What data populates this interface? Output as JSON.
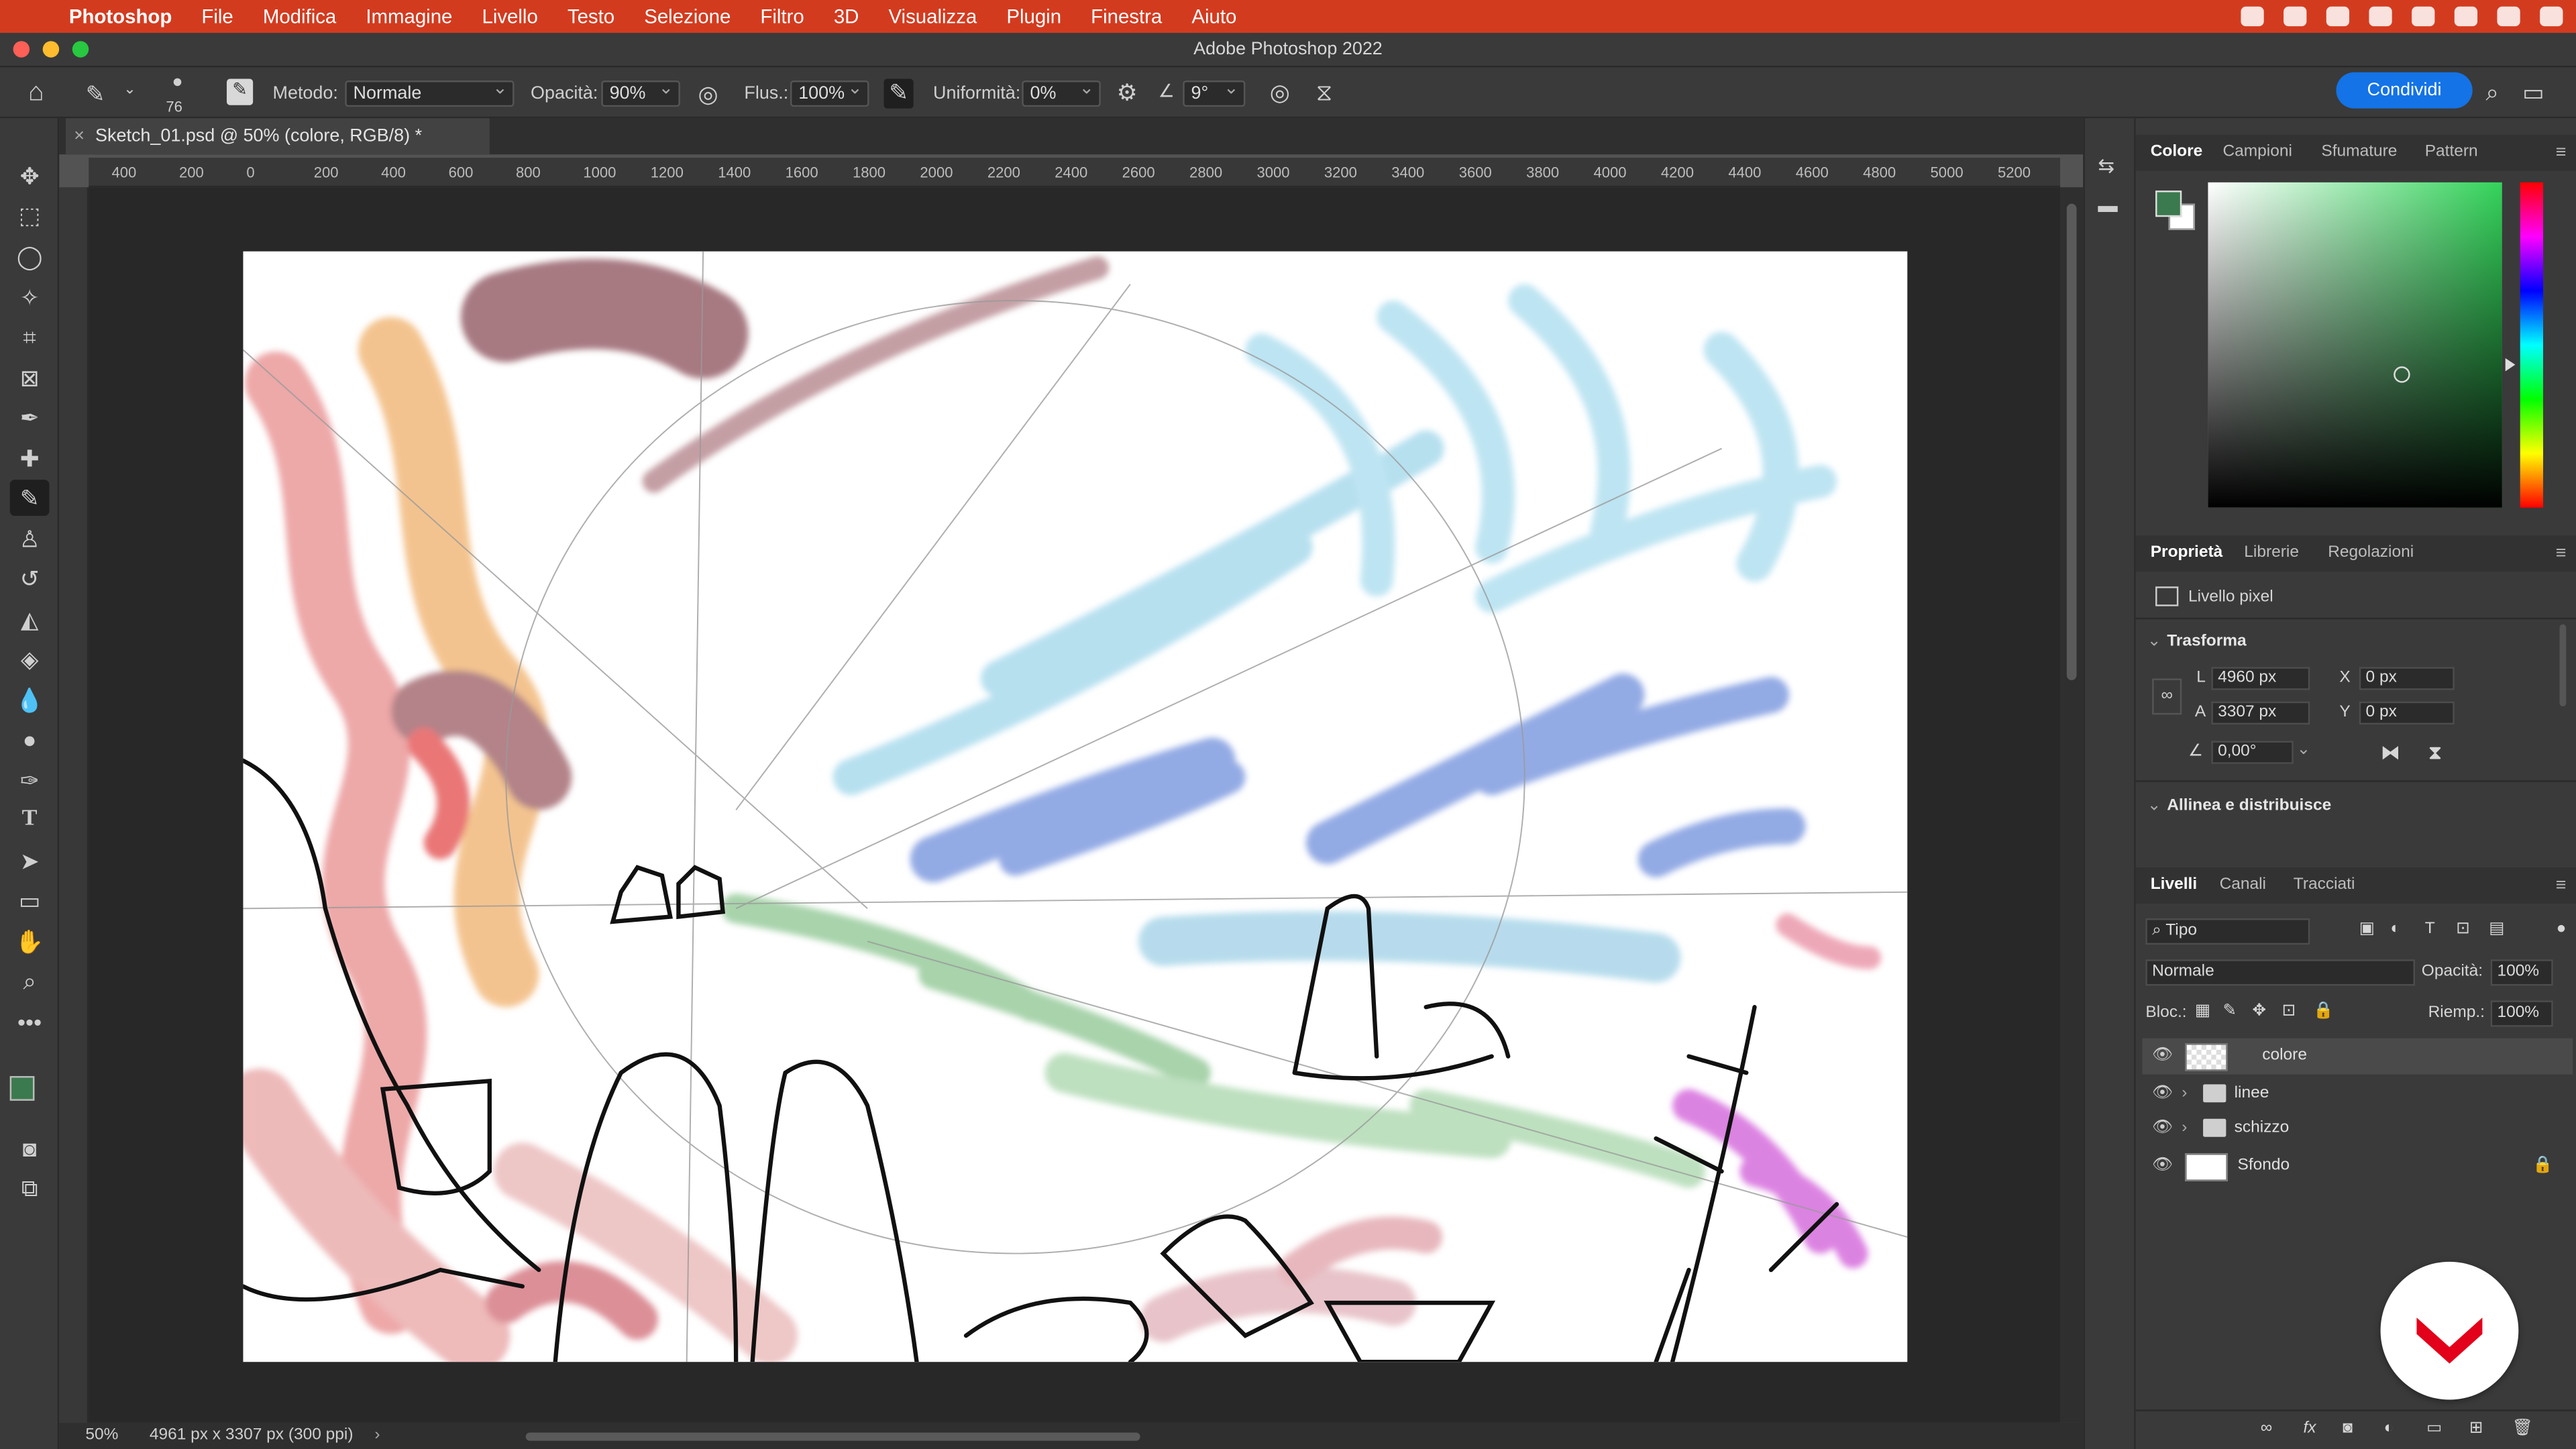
{
  "menubar": {
    "app": "Photoshop",
    "items": [
      "File",
      "Modifica",
      "Immagine",
      "Livello",
      "Testo",
      "Selezione",
      "Filtro",
      "3D",
      "Visualizza",
      "Plugin",
      "Finestra",
      "Aiuto"
    ]
  },
  "window_title": "Adobe Photoshop 2022",
  "options": {
    "brush_size": "76",
    "metodo_label": "Metodo:",
    "metodo_value": "Normale",
    "opacita_label": "Opacità:",
    "opacita_value": "90%",
    "flusso_label": "Flus.:",
    "flusso_value": "100%",
    "uniformita_label": "Uniformità:",
    "uniformita_value": "0%",
    "angle_value": "9°",
    "share_label": "Condividi"
  },
  "document": {
    "tab_title": "Sketch_01.psd @ 50% (colore, RGB/8) *",
    "ruler_ticks": [
      "400",
      "200",
      "0",
      "200",
      "400",
      "600",
      "800",
      "1000",
      "1200",
      "1400",
      "1600",
      "1800",
      "2000",
      "2200",
      "2400",
      "2600",
      "2800",
      "3000",
      "3200",
      "3400",
      "3600",
      "3800",
      "4000",
      "4200",
      "4400",
      "4600",
      "4800",
      "5000",
      "5200"
    ],
    "zoom": "50%",
    "dimensions": "4961 px x 3307 px (300 ppi)"
  },
  "panels": {
    "color_tabs": [
      "Colore",
      "Campioni",
      "Sfumature",
      "Pattern"
    ],
    "foreground_color": "#3a7a4e",
    "props_tabs": [
      "Proprietà",
      "Librerie",
      "Regolazioni"
    ],
    "pixel_layer_label": "Livello pixel",
    "transform_section": "Trasforma",
    "L_label": "L",
    "L_value": "4960 px",
    "A_label": "A",
    "A_value": "3307 px",
    "X_label": "X",
    "X_value": "0 px",
    "Y_label": "Y",
    "Y_value": "0 px",
    "rotation_value": "0,00°",
    "align_section": "Allinea e distribuisce",
    "layers_tabs": [
      "Livelli",
      "Canali",
      "Tracciati"
    ],
    "filter_type": "Tipo",
    "blend_mode": "Normale",
    "opacity_label": "Opacità:",
    "opacity_value": "100%",
    "lock_label": "Bloc.:",
    "fill_label": "Riemp.:",
    "fill_value": "100%",
    "layers": [
      {
        "name": "colore",
        "kind": "pixel",
        "selected": true
      },
      {
        "name": "linee",
        "kind": "group",
        "selected": false
      },
      {
        "name": "schizzo",
        "kind": "group",
        "selected": false
      },
      {
        "name": "Sfondo",
        "kind": "background",
        "selected": false
      }
    ]
  }
}
